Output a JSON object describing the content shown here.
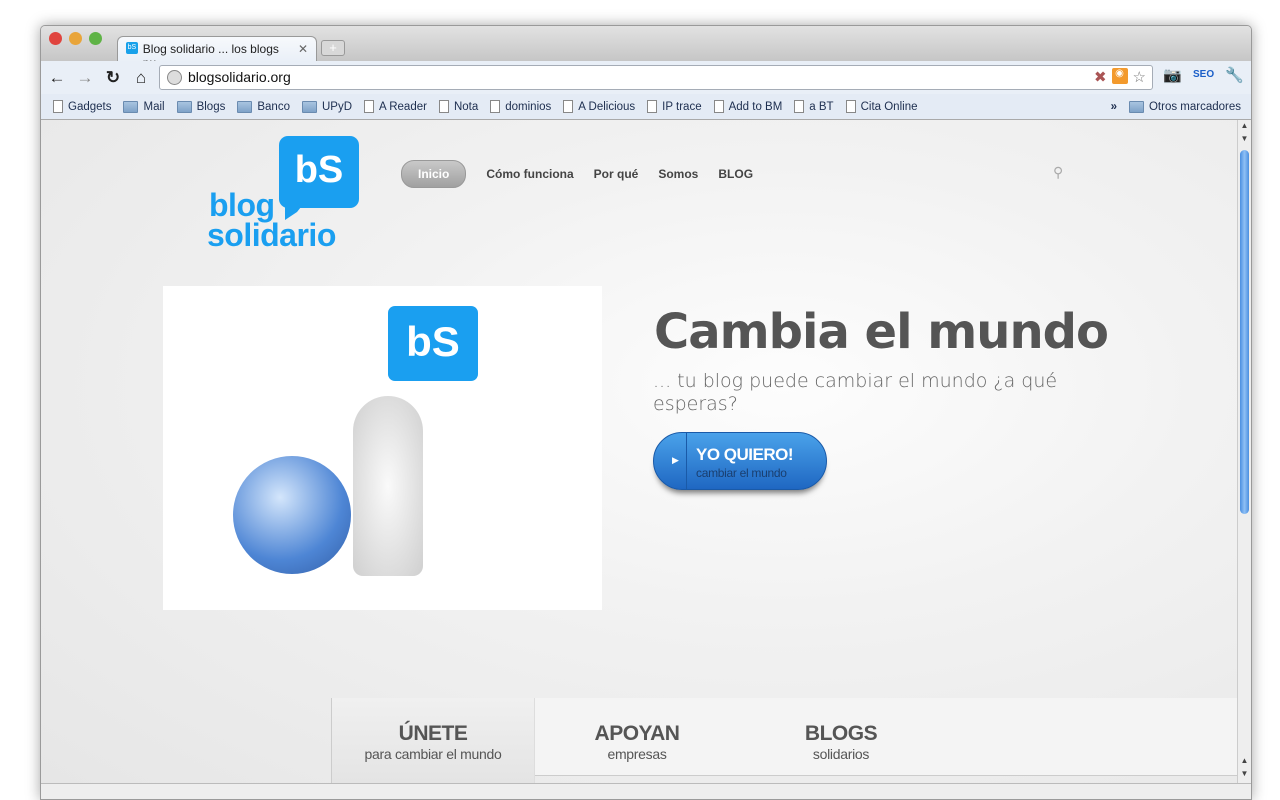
{
  "browser": {
    "tab_title": "Blog solidario ... los blogs pu",
    "favicon": "bS",
    "url": "blogsolidario.org",
    "bookmarks": [
      {
        "label": "Gadgets",
        "type": "page"
      },
      {
        "label": "Mail",
        "type": "folder"
      },
      {
        "label": "Blogs",
        "type": "folder"
      },
      {
        "label": "Banco",
        "type": "folder"
      },
      {
        "label": "UPyD",
        "type": "folder"
      },
      {
        "label": "A Reader",
        "type": "page"
      },
      {
        "label": "Nota",
        "type": "page"
      },
      {
        "label": "dominios",
        "type": "page"
      },
      {
        "label": "A Delicious",
        "type": "page"
      },
      {
        "label": "IP trace",
        "type": "page"
      },
      {
        "label": "Add to BM",
        "type": "page"
      },
      {
        "label": "a BT",
        "type": "page"
      },
      {
        "label": "Cita Online",
        "type": "page"
      }
    ],
    "more": "»",
    "other_bookmarks": "Otros marcadores"
  },
  "site": {
    "logo": {
      "mark": "bS",
      "line1": "blog",
      "line2": "solidario"
    },
    "nav": [
      "Inicio",
      "Cómo funciona",
      "Por qué",
      "Somos",
      "BLOG"
    ],
    "hero": {
      "mark": "bS",
      "title": "Cambia el mundo",
      "subtitle": "... tu blog puede cambiar el mundo ¿a qué esperas?",
      "cta_main": "YO QUIERO!",
      "cta_sub": "cambiar el mundo"
    },
    "tabs": [
      {
        "title": "ÚNETE",
        "sub": "para cambiar el mundo"
      },
      {
        "title": "APOYAN",
        "sub": "empresas"
      },
      {
        "title": "BLOGS",
        "sub": "solidarios"
      }
    ]
  },
  "colors": {
    "brand": "#1a9ff0",
    "cta": "#2f7fd6"
  }
}
